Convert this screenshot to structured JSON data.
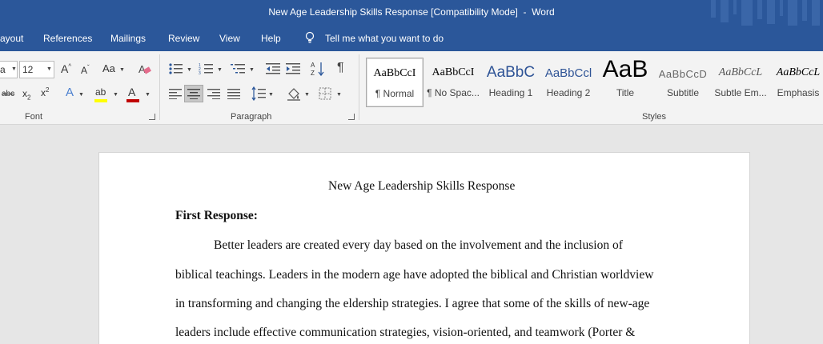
{
  "window": {
    "title": "New Age Leadership Skills Response [Compatibility Mode]  -  Word"
  },
  "menu": {
    "items": [
      "ayout",
      "References",
      "Mailings",
      "Review",
      "View",
      "Help"
    ],
    "tell_me": "Tell me what you want to do"
  },
  "ribbon": {
    "font": {
      "name_partial": "a",
      "size": "12",
      "change_case": "Aa",
      "group_label": "Font",
      "strikethrough": "abc",
      "subscript_base": "x",
      "subscript_mark": "2",
      "superscript_base": "x",
      "superscript_mark": "2",
      "text_effects": "A",
      "highlight": "ab",
      "font_color": "A",
      "font_color_bar": "#c00000",
      "highlight_bar": "#ffff00"
    },
    "paragraph": {
      "group_label": "Paragraph",
      "align_active": "center"
    },
    "styles": {
      "group_label": "Styles",
      "items": [
        {
          "sample": "AaBbCcI",
          "name": "¶ Normal"
        },
        {
          "sample": "AaBbCcI",
          "name": "¶ No Spac..."
        },
        {
          "sample": "AaBbC",
          "name": "Heading 1"
        },
        {
          "sample": "AaBbCcl",
          "name": "Heading 2"
        },
        {
          "sample": "AaB",
          "name": "Title"
        },
        {
          "sample": "AaBbCcD",
          "name": "Subtitle"
        },
        {
          "sample": "AaBbCcL",
          "name": "Subtle Em..."
        },
        {
          "sample": "AaBbCcL",
          "name": "Emphasis"
        }
      ],
      "active_index": 0
    }
  },
  "document": {
    "title": "New Age Leadership Skills Response",
    "heading": "First Response:",
    "lines": [
      "Better leaders are created every day based on the involvement and the inclusion of",
      "biblical teachings. Leaders in the modern age have adopted the biblical and Christian worldview",
      "in transforming and changing the eldership strategies. I agree that some of the skills of new-age",
      "leaders include effective communication strategies, vision-oriented, and teamwork (Porter &"
    ]
  }
}
